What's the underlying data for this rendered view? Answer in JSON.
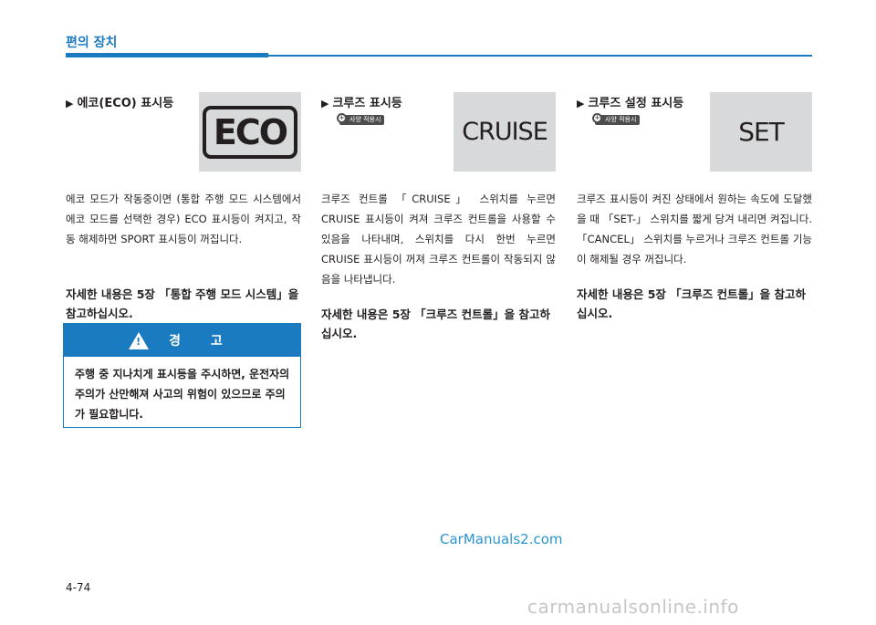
{
  "header": {
    "title": "편의 장치"
  },
  "sections": {
    "eco": {
      "heading": "에코(ECO) 표시등",
      "indicator": "ECO",
      "body": "에코 모드가 작동중이면 (통합 주행 모드 시스템에서 에코 모드를 선택한 경우) ECO 표시등이 켜지고, 작동 해제하면 SPORT 표시등이 꺼집니다.",
      "reference": "자세한 내용은 5장 「통합 주행 모드 시스템」을 참고하십시오."
    },
    "cruise": {
      "heading": "크루즈 표시등",
      "badge": "사양 적용시",
      "indicator": "CRUISE",
      "body": "크루즈 컨트롤 「CRUISE」 스위치를 누르면 CRUISE 표시등이 켜져 크루즈 컨트롤을 사용할 수 있음을 나타내며, 스위치를 다시 한번 누르면 CRUISE 표시등이 꺼져 크루즈 컨트롤이 작동되지 않음을 나타냅니다.",
      "reference": "자세한 내용은 5장 「크루즈 컨트롤」을 참고하십시오."
    },
    "set": {
      "heading": "크루즈 설정 표시등",
      "badge": "사양 적용시",
      "indicator": "SET",
      "body": "크루즈 표시등이 켜진 상태에서 원하는 속도에 도달했을 때 「SET-」 스위치를 짧게 당겨 내리면 켜집니다. 「CANCEL」 스위치를 누르거나 크루즈 컨트롤 기능이 해제될 경우 꺼집니다.",
      "reference": "자세한 내용은 5장 「크루즈 컨트롤」을 참고하십시오."
    }
  },
  "warning": {
    "title": "경 고",
    "body": "주행 중 지나치게 표시등을 주시하면, 운전자의 주의가 산만해져 사고의 위험이 있으므로 주의가 필요합니다."
  },
  "watermark": "CarManuals2.com",
  "page_number": "4-74",
  "footer_watermark": "carmanualsonline.info",
  "colors": {
    "accent": "#1a7bc1",
    "indicator_bg": "#d8d9da"
  }
}
